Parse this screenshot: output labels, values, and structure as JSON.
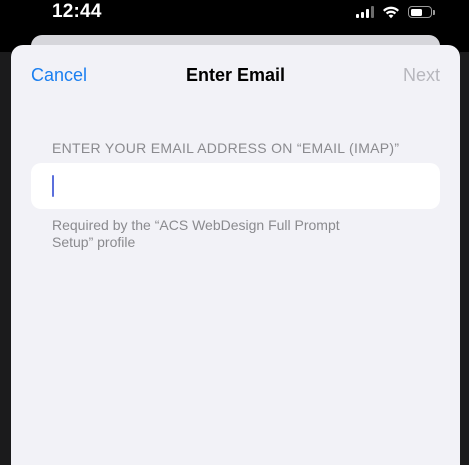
{
  "status_bar": {
    "time": "12:44",
    "icons": [
      "cellular-signal-icon",
      "wifi-icon",
      "battery-icon"
    ]
  },
  "nav": {
    "cancel_label": "Cancel",
    "title": "Enter Email",
    "next_label": "Next"
  },
  "form": {
    "section_header": "ENTER YOUR EMAIL ADDRESS ON “EMAIL (IMAP)”",
    "email_value": "",
    "footer_line1": "Required by the “ACS WebDesign Full Prompt",
    "footer_line2": "Setup” profile"
  },
  "colors": {
    "accent": "#1a7ff0",
    "disabled": "#b7b7bd",
    "background": "#f2f2f7",
    "secondary_text": "#8a8a8e"
  }
}
